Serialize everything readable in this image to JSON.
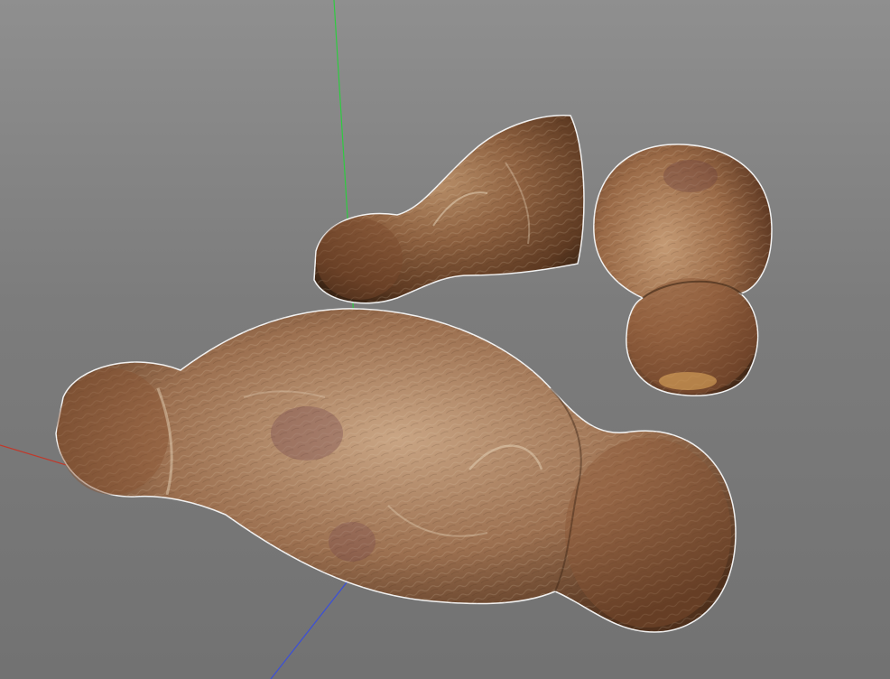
{
  "viewport": {
    "name": "3d-viewport",
    "background": "#858585"
  },
  "axes": {
    "x_axis_color": "#c0392b",
    "y_axis_color": "#2ecc40",
    "z_axis_color": "#3b4fd8"
  },
  "objects": [
    {
      "name": "large-root-model",
      "color": "#8a5a3a"
    },
    {
      "name": "small-root-model",
      "color": "#8a5a3a"
    },
    {
      "name": "upright-root-model",
      "color": "#8a5a3a"
    }
  ]
}
